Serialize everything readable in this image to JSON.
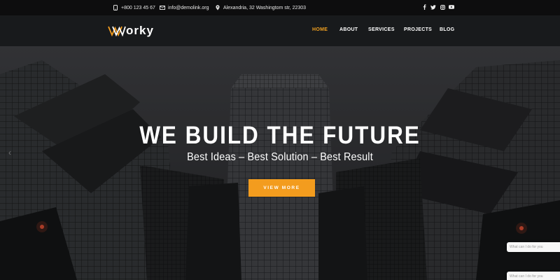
{
  "topbar": {
    "phone": "+800 123 45 67",
    "email": "info@demolink.org",
    "address": "Alexandria, 32 Washingtom str, 22303",
    "social": [
      {
        "icon": "facebook-icon",
        "label": "f"
      },
      {
        "icon": "twitter-icon",
        "label": "t"
      },
      {
        "icon": "instagram-icon",
        "label": "ig"
      },
      {
        "icon": "youtube-icon",
        "label": "yt"
      }
    ]
  },
  "header": {
    "logo_text": "orky",
    "nav": [
      {
        "label": "HOME",
        "active": true
      },
      {
        "label": "ABOUT",
        "active": false
      },
      {
        "label": "SERVICES",
        "active": false
      },
      {
        "label": "PROJECTS",
        "active": false
      },
      {
        "label": "BLOG",
        "active": false
      }
    ]
  },
  "hero": {
    "title": "WE BUILD THE FUTURE",
    "subtitle": "Best Ideas – Best Solution – Best Result",
    "button_label": "VIEW MORE"
  },
  "popups": [
    {
      "text": "What can I do for you"
    },
    {
      "text": "What can I do for you"
    }
  ],
  "colors": {
    "accent": "#f39c1e",
    "topbar": "#0d0d0e",
    "header": "#18191c"
  }
}
